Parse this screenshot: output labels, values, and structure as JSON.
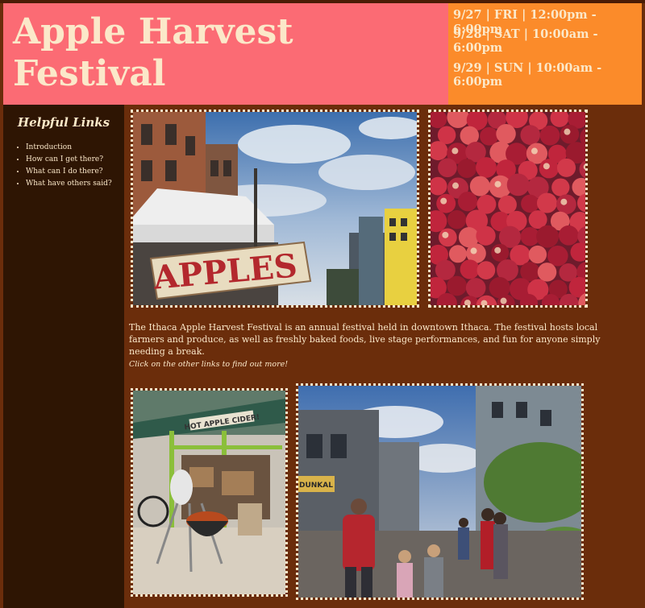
{
  "header": {
    "title_line1": "Apple Harvest",
    "title_line2": "Festival"
  },
  "schedule": [
    "9/27 | FRI | 12:00pm - 6:00pm",
    "9/28 | SAT | 10:00am -",
    "6:00pm",
    "9/29 | SUN | 10:00am -",
    "6:00pm"
  ],
  "sidebar": {
    "heading": "Helpful Links",
    "links": [
      "Introduction",
      "How can I get there?",
      "What can I do there?",
      "What have others said?"
    ]
  },
  "photos": {
    "apples_sign_text": "APPLES",
    "cider_stand_sign_text": "HOT APPLE CIDER!",
    "street_awning_text": "DUNKAL"
  },
  "main": {
    "intro": "The Ithaca Apple Harvest Festival is an annual festival held in downtown Ithaca. The festival hosts local farmers and produce, as well as freshly baked foods, live stage performances, and fun for anyone simply needing a break.",
    "cta": "Click on the other links to find out more!"
  },
  "colors": {
    "background": "#6b2d0b",
    "header": "#fb6b74",
    "schedule": "#fb8b2a",
    "sidebar": "#2e1503",
    "text": "#fbe8c9"
  }
}
